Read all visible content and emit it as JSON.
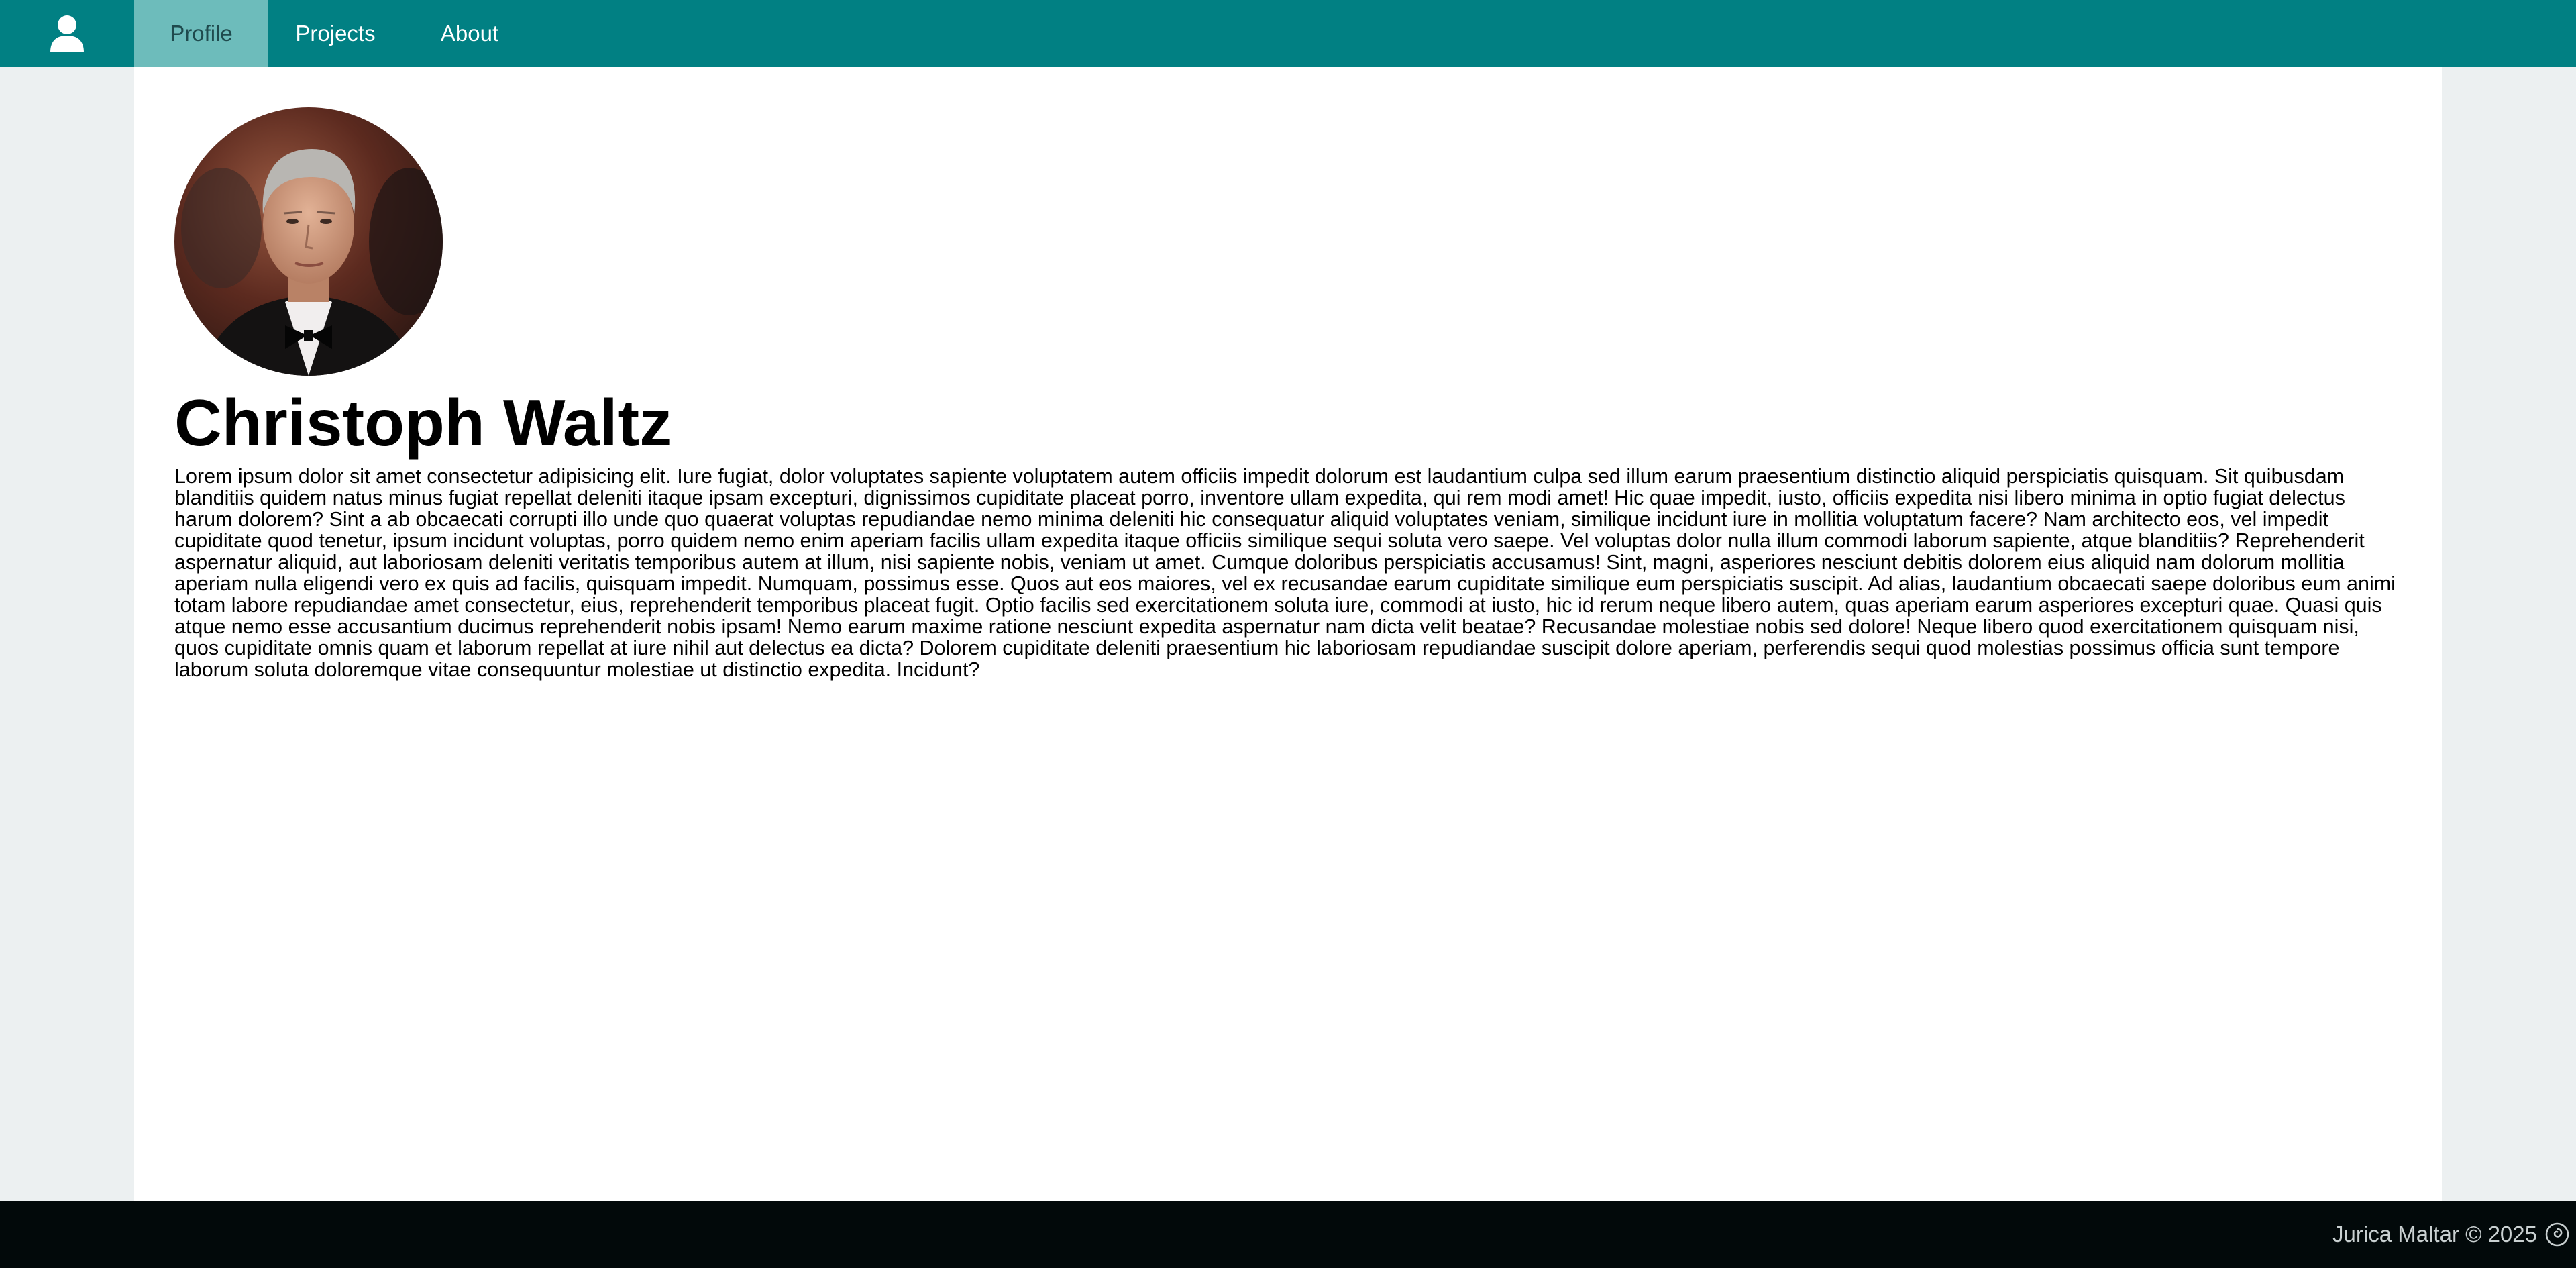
{
  "nav": {
    "home_icon": "user-icon",
    "tabs": [
      {
        "label": "Profile",
        "active": true
      },
      {
        "label": "Projects",
        "active": false
      },
      {
        "label": "About",
        "active": false
      }
    ]
  },
  "profile": {
    "name": "Christoph Waltz",
    "bio": "Lorem ipsum dolor sit amet consectetur adipisicing elit. Iure fugiat, dolor voluptates sapiente voluptatem autem officiis impedit dolorum est laudantium culpa sed illum earum praesentium distinctio aliquid perspiciatis quisquam. Sit quibusdam blanditiis quidem natus minus fugiat repellat deleniti itaque ipsam excepturi, dignissimos cupiditate placeat porro, inventore ullam expedita, qui rem modi amet! Hic quae impedit, iusto, officiis expedita nisi libero minima in optio fugiat delectus harum dolorem? Sint a ab obcaecati corrupti illo unde quo quaerat voluptas repudiandae nemo minima deleniti hic consequatur aliquid voluptates veniam, similique incidunt iure in mollitia voluptatum facere? Nam architecto eos, vel impedit cupiditate quod tenetur, ipsum incidunt voluptas, porro quidem nemo enim aperiam facilis ullam expedita itaque officiis similique sequi soluta vero saepe. Vel voluptas dolor nulla illum commodi laborum sapiente, atque blanditiis? Reprehenderit aspernatur aliquid, aut laboriosam deleniti veritatis temporibus autem at illum, nisi sapiente nobis, veniam ut amet. Cumque doloribus perspiciatis accusamus! Sint, magni, asperiores nesciunt debitis dolorem eius aliquid nam dolorum mollitia aperiam nulla eligendi vero ex quis ad facilis, quisquam impedit. Numquam, possimus esse. Quos aut eos maiores, vel ex recusandae earum cupiditate similique eum perspiciatis suscipit. Ad alias, laudantium obcaecati saepe doloribus eum animi totam labore repudiandae amet consectetur, eius, reprehenderit temporibus placeat fugit. Optio facilis sed exercitationem soluta iure, commodi at iusto, hic id rerum neque libero autem, quas aperiam earum asperiores excepturi quae. Quasi quis atque nemo esse accusantium ducimus reprehenderit nobis ipsam! Nemo earum maxime ratione nesciunt expedita aspernatur nam dicta velit beatae? Recusandae molestiae nobis sed dolore! Neque libero quod exercitationem quisquam nisi, quos cupiditate omnis quam et laborum repellat at iure nihil aut delectus ea dicta? Dolorem cupiditate deleniti praesentium hic laboriosam repudiandae suscipit dolore aperiam, perferendis sequi quod molestias possimus officia sunt tempore laborum soluta doloremque vitae consequuntur molestiae ut distinctio expedita. Incidunt?"
  },
  "footer": {
    "text": "Jurica Maltar © 2025",
    "icon": "spiral-icon"
  },
  "colors": {
    "navbar": "#018083",
    "active_tab": "#6dbcbb",
    "page_background": "#ecf0f1",
    "content_background": "#ffffff",
    "footer": "#02090a"
  }
}
